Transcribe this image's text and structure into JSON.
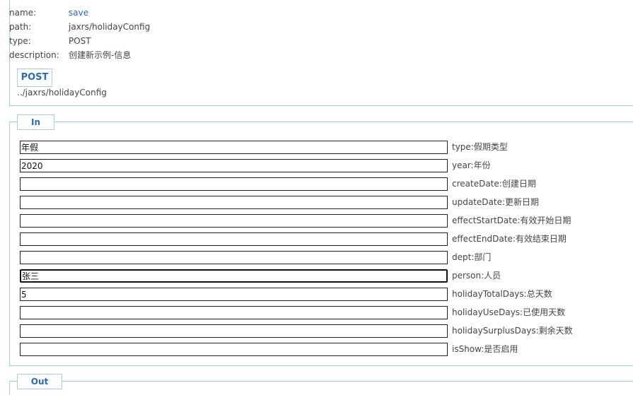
{
  "meta": {
    "name_key": "name:",
    "name_value": "save",
    "path_key": "path:",
    "path_value": "jaxrs/holidayConfig",
    "type_key": "type:",
    "type_value": "POST",
    "description_key": "description:",
    "description_value": "创建新示例-信息"
  },
  "method_badge": "POST",
  "endpoint_url": "../jaxrs/holidayConfig",
  "in_section": {
    "legend": "In",
    "params": [
      {
        "label": "type:假期类型",
        "value": "年假"
      },
      {
        "label": "year:年份",
        "value": "2020"
      },
      {
        "label": "createDate:创建日期",
        "value": ""
      },
      {
        "label": "updateDate:更新日期",
        "value": ""
      },
      {
        "label": "effectStartDate:有效开始日期",
        "value": ""
      },
      {
        "label": "effectEndDate:有效结束日期",
        "value": ""
      },
      {
        "label": "dept:部门",
        "value": ""
      },
      {
        "label": "person:人员",
        "value": "张三"
      },
      {
        "label": "holidayTotalDays:总天数",
        "value": "5"
      },
      {
        "label": "holidayUseDays:已使用天数",
        "value": ""
      },
      {
        "label": "holidaySurplusDays:剩余天数",
        "value": ""
      },
      {
        "label": "isShow:是否启用",
        "value": ""
      }
    ]
  },
  "out_section": {
    "legend": "Out"
  },
  "colors": {
    "border": "#a9cce3",
    "accent": "#2a6ab0"
  }
}
